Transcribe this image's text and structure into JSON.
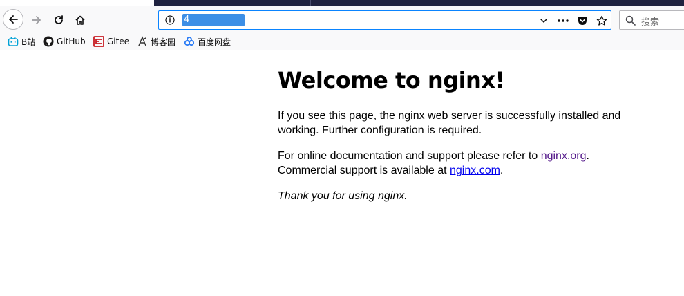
{
  "browser": {
    "url": "4",
    "search_placeholder": "搜索",
    "bookmarks": [
      {
        "label": "B站",
        "icon": "bilibili-icon"
      },
      {
        "label": "GitHub",
        "icon": "github-icon"
      },
      {
        "label": "Gitee",
        "icon": "gitee-icon"
      },
      {
        "label": "博客园",
        "icon": "cnblogs-icon"
      },
      {
        "label": "百度网盘",
        "icon": "baidu-pan-icon"
      }
    ],
    "colors": {
      "accent": "#0a84ff",
      "selection": "#3d8fe6",
      "titlebar": "#202340"
    }
  },
  "page": {
    "title": "Welcome to nginx!",
    "p1": "If you see this page, the nginx web server is successfully installed and working. Further configuration is required.",
    "p2_prefix": "For online documentation and support please refer to ",
    "link_org": "nginx.org",
    "p2_mid": ".",
    "p2_line2": "Commercial support is available at ",
    "link_com": "nginx.com",
    "p2_end": ".",
    "p3": "Thank you for using nginx."
  }
}
